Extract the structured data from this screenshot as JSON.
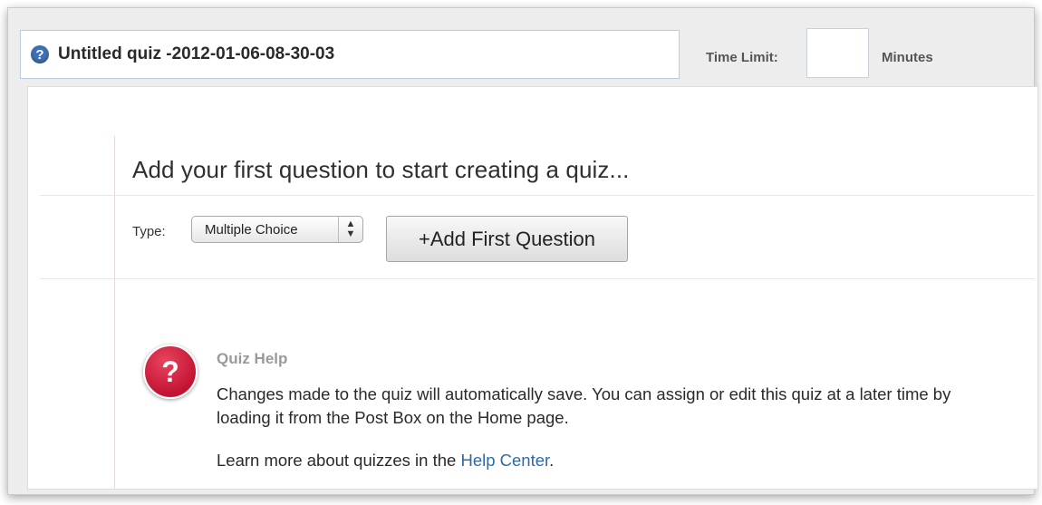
{
  "quiz": {
    "title": "Untitled quiz -2012-01-06-08-30-03",
    "time_limit_label": "Time Limit:",
    "time_limit_value": "",
    "minutes_label": "Minutes"
  },
  "main": {
    "heading": "Add your first question to start creating a quiz...",
    "type_label": "Type:",
    "type_selected": "Multiple Choice",
    "add_button_label": "+Add First Question"
  },
  "help": {
    "title": "Quiz Help",
    "text": "Changes made to the quiz will automatically save. You can assign or edit this quiz at a later time by loading it from the Post Box on the Home page.",
    "more_prefix": "Learn more about quizzes in the ",
    "link_label": "Help Center",
    "more_suffix": "."
  },
  "icons": {
    "info": "question-circle-icon",
    "help": "help-icon"
  },
  "colors": {
    "accent_blue": "#3f6fb3",
    "help_red": "#c21432",
    "link": "#2f6aa8"
  }
}
